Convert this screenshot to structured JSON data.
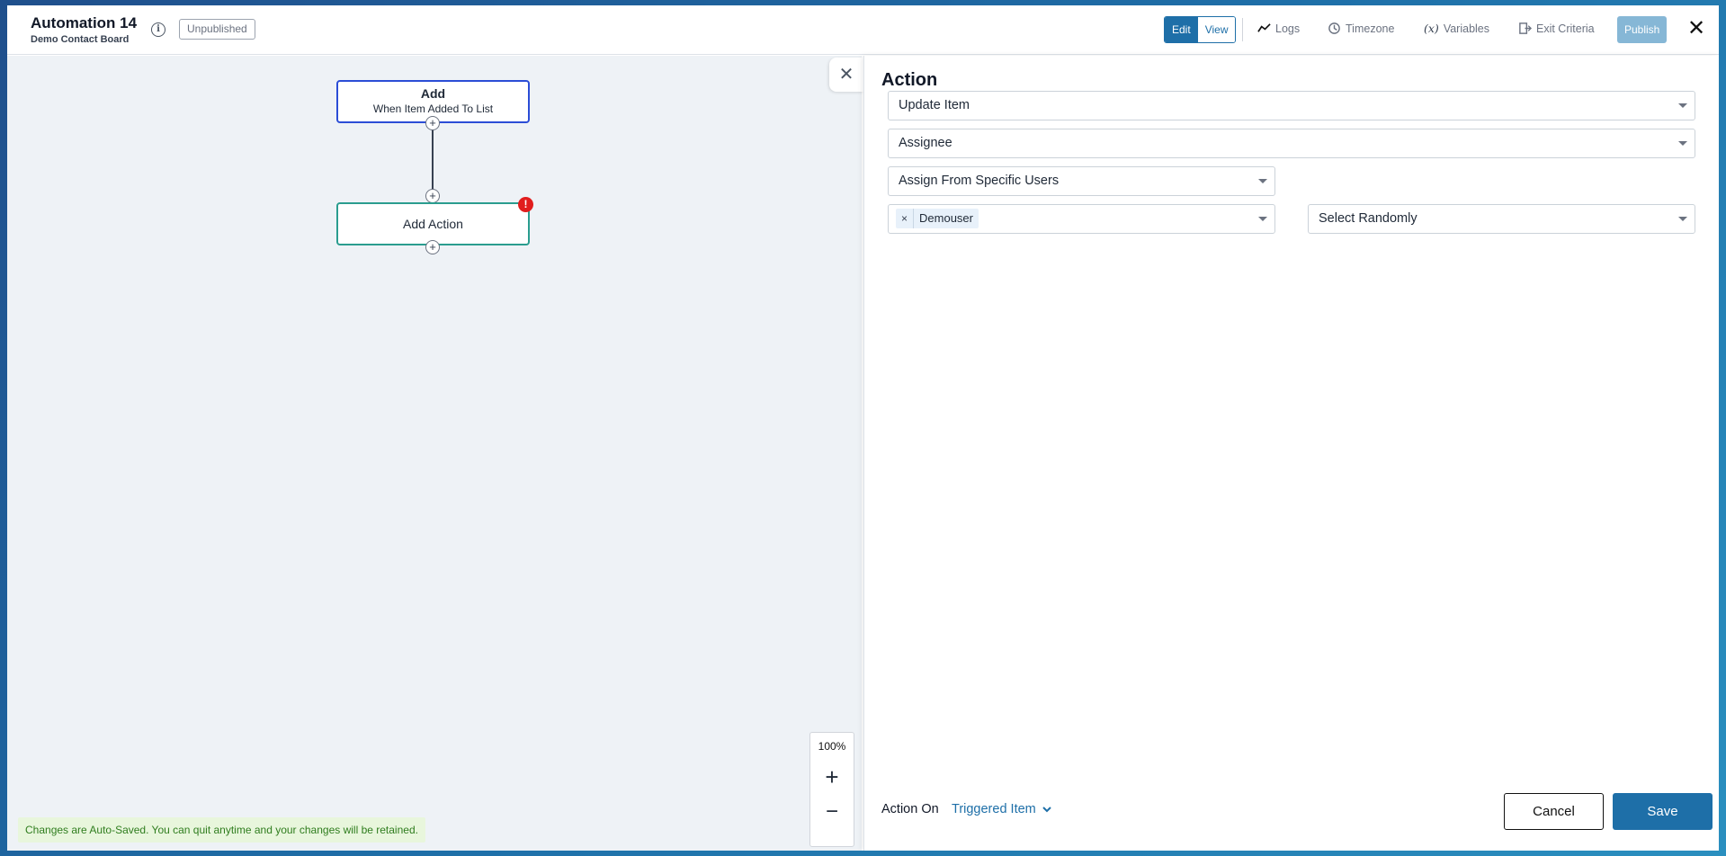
{
  "header": {
    "title": "Automation 14",
    "subtitle": "Demo Contact Board",
    "status": "Unpublished",
    "mode_edit": "Edit",
    "mode_view": "View",
    "links": {
      "logs": "Logs",
      "timezone": "Timezone",
      "variables": "Variables",
      "exit_criteria": "Exit Criteria"
    },
    "publish": "Publish",
    "close_glyph": "✕"
  },
  "canvas": {
    "trigger_title": "Add",
    "trigger_subtitle": "When Item Added To List",
    "action_node": "Add Action",
    "error_glyph": "!",
    "plus_glyph": "+",
    "zoom_level": "100%",
    "zoom_in": "+",
    "zoom_out": "−",
    "autosave_note": "Changes are Auto-Saved. You can quit anytime and your changes will be retained."
  },
  "panel": {
    "close_glyph": "✕",
    "title": "Action",
    "action_type": "Update Item",
    "field": "Assignee",
    "assign_mode": "Assign From Specific Users",
    "selected_user": "Demouser",
    "chip_remove_glyph": "×",
    "distribution": "Select Randomly",
    "footer_label": "Action On",
    "footer_value": "Triggered Item",
    "cancel": "Cancel",
    "save": "Save"
  },
  "colors": {
    "accent": "#1e6fa8",
    "trigger_border": "#2b4dd6",
    "action_border": "#2a9d8f",
    "error": "#e11d1d"
  }
}
